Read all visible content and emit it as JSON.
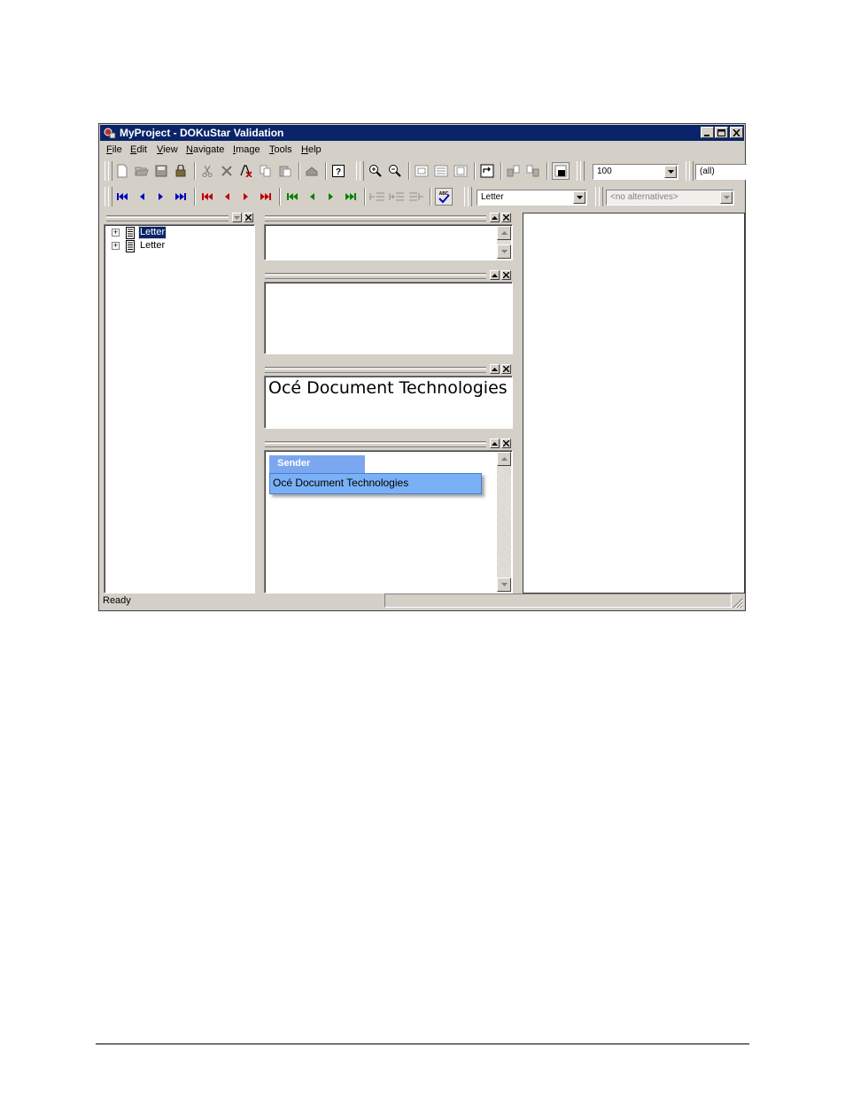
{
  "window": {
    "title": "MyProject - DOKuStar Validation"
  },
  "menu": {
    "file": {
      "key": "F",
      "rest": "ile"
    },
    "edit": {
      "key": "E",
      "rest": "dit"
    },
    "view": {
      "key": "V",
      "rest": "iew"
    },
    "navigate": {
      "key": "N",
      "rest": "avigate"
    },
    "image": {
      "key": "I",
      "rest": "mage"
    },
    "tools": {
      "key": "T",
      "rest": "ools"
    },
    "help": {
      "key": "H",
      "rest": "elp"
    }
  },
  "toolbar1": {
    "zoom_value": "100",
    "filter_value": "(all)",
    "icons": [
      "new-icon",
      "open-icon",
      "save-icon",
      "lock-icon",
      "cut-icon",
      "delete-icon",
      "delete-field-icon",
      "copy-icon",
      "paste-icon",
      "undo-icon",
      "help-icon",
      "zoom-in-icon",
      "zoom-out-icon",
      "fit-page-icon",
      "fit-width-icon",
      "fit-height-icon",
      "rotate-icon",
      "prev-image-icon",
      "next-image-icon",
      "contrast-icon"
    ]
  },
  "toolbar2": {
    "doc_type_value": "Letter",
    "alternatives_placeholder": "<no alternatives>",
    "colors": {
      "blue": "#0000c0",
      "red": "#c00000",
      "green": "#008000"
    }
  },
  "tree": {
    "items": [
      {
        "label": "Letter",
        "selected": true
      },
      {
        "label": "Letter",
        "selected": false
      }
    ]
  },
  "panels": {
    "text_panel": {
      "content": "Océ Document Technologies"
    },
    "field_panel": {
      "field_title": "Sender",
      "field_value": "Océ Document Technologies",
      "title_color": "#7aa7ef",
      "value_color": "#7ab0f5"
    }
  },
  "status": {
    "text": "Ready"
  }
}
